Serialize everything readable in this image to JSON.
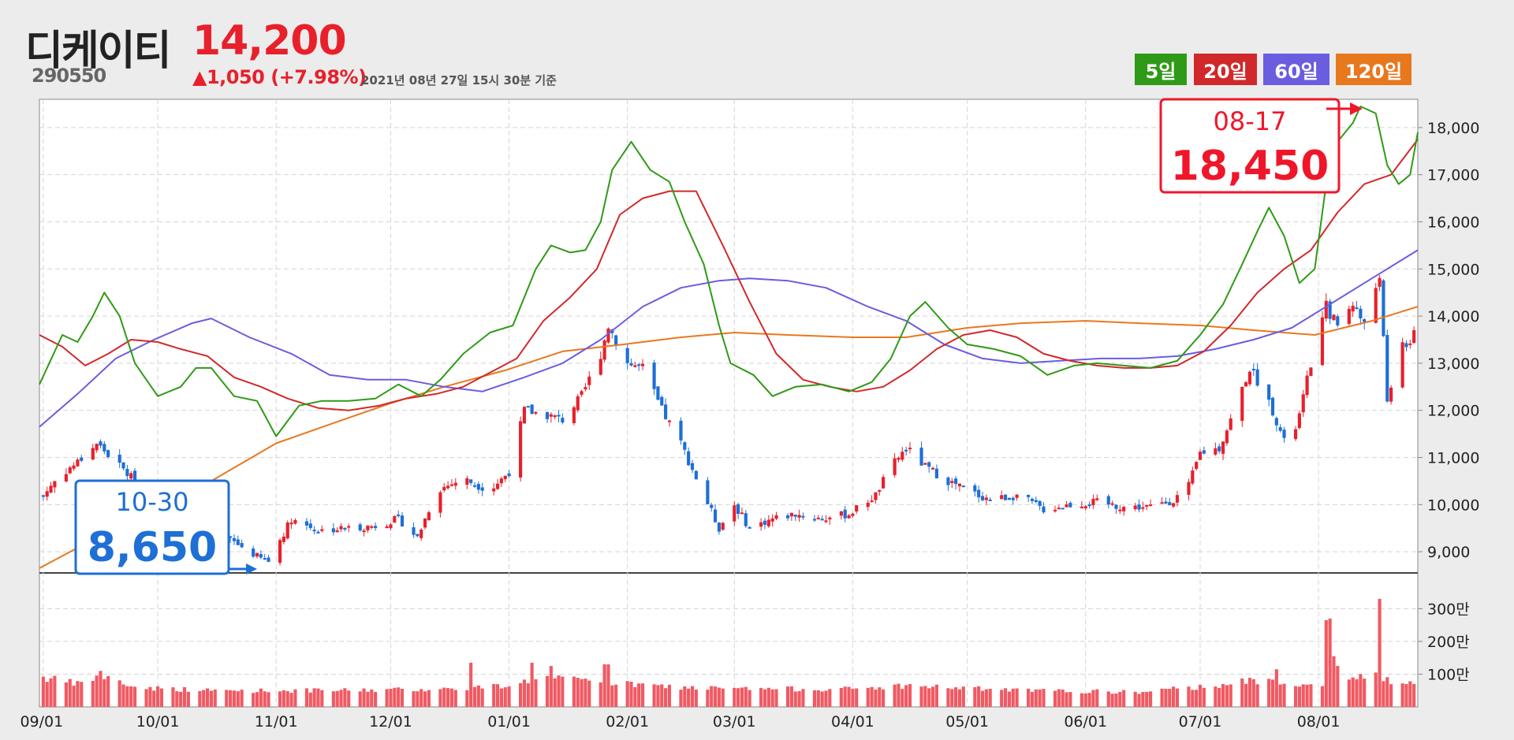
{
  "header": {
    "stock_name": "디케이티",
    "stock_code": "290550",
    "price": "14,200",
    "change": "▲1,050 (+7.98%)",
    "as_of": "2021년 08년 27일 15시 30분 기준"
  },
  "legend": [
    {
      "label": "5일",
      "color": "#2f9a17"
    },
    {
      "label": "20일",
      "color": "#d1292b"
    },
    {
      "label": "60일",
      "color": "#6a5de0"
    },
    {
      "label": "120일",
      "color": "#e8781e"
    }
  ],
  "colors": {
    "up": "#e8202b",
    "down": "#1e6fd6",
    "volume": "#f05a63"
  },
  "annotations": {
    "high": {
      "date": "08-17",
      "value": "18,450"
    },
    "low": {
      "date": "10-30",
      "value": "8,650"
    }
  },
  "chart_data": {
    "type": "candlestick",
    "x_range": [
      "2020-08-31",
      "2021-08-27"
    ],
    "x_ticks": [
      "09/01",
      "10/01",
      "11/01",
      "12/01",
      "01/01",
      "02/01",
      "03/01",
      "04/01",
      "05/01",
      "06/01",
      "07/01",
      "08/01"
    ],
    "price_axis": {
      "ticks": [
        "18,000",
        "17,000",
        "16,000",
        "15,000",
        "14,000",
        "13,000",
        "12,000",
        "11,000",
        "10,000",
        "9,000"
      ],
      "ylim": [
        8550,
        18600
      ]
    },
    "volume_axis": {
      "ticks": [
        "300만",
        "200만",
        "100만"
      ],
      "ylim": [
        0,
        3900000
      ]
    },
    "price_anchors": [
      [
        "2020-09-01",
        10200
      ],
      [
        "2020-09-05",
        10600
      ],
      [
        "2020-09-10",
        10900
      ],
      [
        "2020-09-15",
        11300
      ],
      [
        "2020-09-20",
        10900
      ],
      [
        "2020-09-25",
        10500
      ],
      [
        "2020-10-01",
        10100
      ],
      [
        "2020-10-07",
        9800
      ],
      [
        "2020-10-14",
        9500
      ],
      [
        "2020-10-21",
        9200
      ],
      [
        "2020-10-28",
        8850
      ],
      [
        "2020-10-30",
        8800
      ],
      [
        "2020-11-05",
        9700
      ],
      [
        "2020-11-12",
        9450
      ],
      [
        "2020-11-20",
        9500
      ],
      [
        "2020-11-27",
        9550
      ],
      [
        "2020-12-03",
        9700
      ],
      [
        "2020-12-08",
        9300
      ],
      [
        "2020-12-13",
        10300
      ],
      [
        "2020-12-20",
        10550
      ],
      [
        "2020-12-27",
        10300
      ],
      [
        "2021-01-01",
        10700
      ],
      [
        "2021-01-05",
        12000
      ],
      [
        "2021-01-11",
        11900
      ],
      [
        "2021-01-15",
        11800
      ],
      [
        "2021-01-20",
        12300
      ],
      [
        "2021-01-25",
        13200
      ],
      [
        "2021-01-27",
        13800
      ],
      [
        "2021-02-01",
        13000
      ],
      [
        "2021-02-05",
        12900
      ],
      [
        "2021-02-10",
        12000
      ],
      [
        "2021-02-15",
        11300
      ],
      [
        "2021-02-21",
        10200
      ],
      [
        "2021-02-25",
        9500
      ],
      [
        "2021-03-01",
        10000
      ],
      [
        "2021-03-05",
        9500
      ],
      [
        "2021-03-11",
        9700
      ],
      [
        "2021-03-17",
        9800
      ],
      [
        "2021-03-24",
        9700
      ],
      [
        "2021-03-31",
        9800
      ],
      [
        "2021-04-07",
        10200
      ],
      [
        "2021-04-11",
        10800
      ],
      [
        "2021-04-15",
        11200
      ],
      [
        "2021-04-20",
        10800
      ],
      [
        "2021-04-26",
        10500
      ],
      [
        "2021-05-01",
        10300
      ],
      [
        "2021-05-07",
        10100
      ],
      [
        "2021-05-14",
        10200
      ],
      [
        "2021-05-21",
        9900
      ],
      [
        "2021-05-28",
        10000
      ],
      [
        "2021-06-04",
        10050
      ],
      [
        "2021-06-11",
        9950
      ],
      [
        "2021-06-18",
        9950
      ],
      [
        "2021-06-24",
        10100
      ],
      [
        "2021-06-28",
        10400
      ],
      [
        "2021-07-01",
        11100
      ],
      [
        "2021-07-06",
        11200
      ],
      [
        "2021-07-10",
        12000
      ],
      [
        "2021-07-14",
        12900
      ],
      [
        "2021-07-17",
        12500
      ],
      [
        "2021-07-20",
        12000
      ],
      [
        "2021-07-24",
        11100
      ],
      [
        "2021-07-27",
        11900
      ],
      [
        "2021-07-30",
        13000
      ],
      [
        "2021-08-03",
        14200
      ],
      [
        "2021-08-06",
        13800
      ],
      [
        "2021-08-10",
        14300
      ],
      [
        "2021-08-13",
        13800
      ],
      [
        "2021-08-17",
        14900
      ],
      [
        "2021-08-19",
        12100
      ],
      [
        "2021-08-23",
        13500
      ],
      [
        "2021-08-25",
        13300
      ],
      [
        "2021-08-27",
        14200
      ]
    ],
    "ma5": [
      [
        "2020-08-31",
        12550
      ],
      [
        "2020-09-06",
        13600
      ],
      [
        "2020-09-10",
        13450
      ],
      [
        "2020-09-14",
        14000
      ],
      [
        "2020-09-17",
        14500
      ],
      [
        "2020-09-21",
        14000
      ],
      [
        "2020-09-25",
        13000
      ],
      [
        "2020-10-01",
        12300
      ],
      [
        "2020-10-07",
        12500
      ],
      [
        "2020-10-11",
        12900
      ],
      [
        "2020-10-15",
        12900
      ],
      [
        "2020-10-21",
        12300
      ],
      [
        "2020-10-27",
        12200
      ],
      [
        "2020-11-01",
        11450
      ],
      [
        "2020-11-07",
        12100
      ],
      [
        "2020-11-13",
        12200
      ],
      [
        "2020-11-20",
        12200
      ],
      [
        "2020-11-27",
        12250
      ],
      [
        "2020-12-03",
        12550
      ],
      [
        "2020-12-09",
        12300
      ],
      [
        "2020-12-14",
        12650
      ],
      [
        "2020-12-20",
        13200
      ],
      [
        "2020-12-27",
        13650
      ],
      [
        "2021-01-02",
        13800
      ],
      [
        "2021-01-08",
        15000
      ],
      [
        "2021-01-12",
        15500
      ],
      [
        "2021-01-17",
        15350
      ],
      [
        "2021-01-21",
        15400
      ],
      [
        "2021-01-25",
        16000
      ],
      [
        "2021-01-28",
        17100
      ],
      [
        "2021-02-02",
        17700
      ],
      [
        "2021-02-07",
        17100
      ],
      [
        "2021-02-12",
        16850
      ],
      [
        "2021-02-16",
        16000
      ],
      [
        "2021-02-21",
        15100
      ],
      [
        "2021-02-25",
        13800
      ],
      [
        "2021-02-28",
        13000
      ],
      [
        "2021-03-06",
        12750
      ],
      [
        "2021-03-11",
        12300
      ],
      [
        "2021-03-17",
        12500
      ],
      [
        "2021-03-24",
        12550
      ],
      [
        "2021-03-31",
        12400
      ],
      [
        "2021-04-06",
        12600
      ],
      [
        "2021-04-11",
        13100
      ],
      [
        "2021-04-16",
        14000
      ],
      [
        "2021-04-20",
        14300
      ],
      [
        "2021-04-26",
        13750
      ],
      [
        "2021-05-01",
        13400
      ],
      [
        "2021-05-08",
        13300
      ],
      [
        "2021-05-15",
        13150
      ],
      [
        "2021-05-22",
        12750
      ],
      [
        "2021-05-29",
        12950
      ],
      [
        "2021-06-04",
        13000
      ],
      [
        "2021-06-11",
        12950
      ],
      [
        "2021-06-18",
        12900
      ],
      [
        "2021-06-25",
        13050
      ],
      [
        "2021-07-01",
        13600
      ],
      [
        "2021-07-07",
        14250
      ],
      [
        "2021-07-12",
        15100
      ],
      [
        "2021-07-16",
        15800
      ],
      [
        "2021-07-19",
        16300
      ],
      [
        "2021-07-23",
        15700
      ],
      [
        "2021-07-27",
        14700
      ],
      [
        "2021-07-31",
        15000
      ],
      [
        "2021-08-03",
        16800
      ],
      [
        "2021-08-06",
        17700
      ],
      [
        "2021-08-10",
        18100
      ],
      [
        "2021-08-12",
        18450
      ],
      [
        "2021-08-16",
        18300
      ],
      [
        "2021-08-19",
        17200
      ],
      [
        "2021-08-22",
        16800
      ],
      [
        "2021-08-25",
        17000
      ],
      [
        "2021-08-27",
        17900
      ]
    ],
    "ma20": [
      [
        "2020-08-31",
        13600
      ],
      [
        "2020-09-06",
        13350
      ],
      [
        "2020-09-12",
        12950
      ],
      [
        "2020-09-18",
        13200
      ],
      [
        "2020-09-24",
        13500
      ],
      [
        "2020-10-01",
        13450
      ],
      [
        "2020-10-07",
        13300
      ],
      [
        "2020-10-14",
        13150
      ],
      [
        "2020-10-21",
        12700
      ],
      [
        "2020-10-28",
        12500
      ],
      [
        "2020-11-04",
        12250
      ],
      [
        "2020-11-12",
        12050
      ],
      [
        "2020-11-20",
        12000
      ],
      [
        "2020-11-28",
        12100
      ],
      [
        "2020-12-05",
        12250
      ],
      [
        "2020-12-13",
        12350
      ],
      [
        "2020-12-20",
        12500
      ],
      [
        "2020-12-27",
        12800
      ],
      [
        "2021-01-03",
        13100
      ],
      [
        "2021-01-10",
        13900
      ],
      [
        "2021-01-17",
        14400
      ],
      [
        "2021-01-24",
        15000
      ],
      [
        "2021-01-30",
        16150
      ],
      [
        "2021-02-05",
        16500
      ],
      [
        "2021-02-12",
        16650
      ],
      [
        "2021-02-19",
        16650
      ],
      [
        "2021-02-26",
        15500
      ],
      [
        "2021-03-05",
        14300
      ],
      [
        "2021-03-12",
        13200
      ],
      [
        "2021-03-19",
        12650
      ],
      [
        "2021-03-26",
        12500
      ],
      [
        "2021-04-02",
        12400
      ],
      [
        "2021-04-09",
        12500
      ],
      [
        "2021-04-16",
        12850
      ],
      [
        "2021-04-23",
        13300
      ],
      [
        "2021-04-30",
        13600
      ],
      [
        "2021-05-07",
        13700
      ],
      [
        "2021-05-14",
        13550
      ],
      [
        "2021-05-21",
        13200
      ],
      [
        "2021-05-28",
        13050
      ],
      [
        "2021-06-04",
        12950
      ],
      [
        "2021-06-11",
        12900
      ],
      [
        "2021-06-18",
        12900
      ],
      [
        "2021-06-25",
        12950
      ],
      [
        "2021-07-02",
        13250
      ],
      [
        "2021-07-09",
        13800
      ],
      [
        "2021-07-16",
        14500
      ],
      [
        "2021-07-23",
        15000
      ],
      [
        "2021-07-30",
        15400
      ],
      [
        "2021-08-06",
        16200
      ],
      [
        "2021-08-13",
        16800
      ],
      [
        "2021-08-20",
        17000
      ],
      [
        "2021-08-27",
        17750
      ]
    ],
    "ma60": [
      [
        "2020-08-31",
        11650
      ],
      [
        "2020-09-10",
        12350
      ],
      [
        "2020-09-20",
        13100
      ],
      [
        "2020-09-30",
        13500
      ],
      [
        "2020-10-10",
        13850
      ],
      [
        "2020-10-15",
        13950
      ],
      [
        "2020-10-25",
        13550
      ],
      [
        "2020-11-05",
        13200
      ],
      [
        "2020-11-15",
        12750
      ],
      [
        "2020-11-25",
        12650
      ],
      [
        "2020-12-05",
        12650
      ],
      [
        "2020-12-15",
        12500
      ],
      [
        "2020-12-25",
        12400
      ],
      [
        "2021-01-05",
        12700
      ],
      [
        "2021-01-15",
        13000
      ],
      [
        "2021-01-25",
        13500
      ],
      [
        "2021-02-05",
        14200
      ],
      [
        "2021-02-15",
        14600
      ],
      [
        "2021-02-25",
        14750
      ],
      [
        "2021-03-05",
        14800
      ],
      [
        "2021-03-15",
        14750
      ],
      [
        "2021-03-25",
        14600
      ],
      [
        "2021-04-05",
        14200
      ],
      [
        "2021-04-15",
        13900
      ],
      [
        "2021-04-25",
        13400
      ],
      [
        "2021-05-05",
        13100
      ],
      [
        "2021-05-15",
        13000
      ],
      [
        "2021-05-25",
        13050
      ],
      [
        "2021-06-05",
        13100
      ],
      [
        "2021-06-15",
        13100
      ],
      [
        "2021-06-25",
        13150
      ],
      [
        "2021-07-05",
        13300
      ],
      [
        "2021-07-15",
        13500
      ],
      [
        "2021-07-25",
        13750
      ],
      [
        "2021-08-05",
        14300
      ],
      [
        "2021-08-15",
        14800
      ],
      [
        "2021-08-27",
        15400
      ]
    ],
    "ma120": [
      [
        "2020-08-31",
        8650
      ],
      [
        "2020-09-15",
        9300
      ],
      [
        "2020-10-01",
        9950
      ],
      [
        "2020-10-15",
        10500
      ],
      [
        "2020-11-01",
        11300
      ],
      [
        "2020-11-15",
        11700
      ],
      [
        "2020-12-01",
        12150
      ],
      [
        "2020-12-15",
        12500
      ],
      [
        "2020-12-31",
        12850
      ],
      [
        "2021-01-15",
        13250
      ],
      [
        "2021-01-31",
        13400
      ],
      [
        "2021-02-15",
        13550
      ],
      [
        "2021-03-01",
        13650
      ],
      [
        "2021-03-15",
        13600
      ],
      [
        "2021-04-01",
        13550
      ],
      [
        "2021-04-15",
        13550
      ],
      [
        "2021-05-01",
        13750
      ],
      [
        "2021-05-15",
        13850
      ],
      [
        "2021-06-01",
        13900
      ],
      [
        "2021-06-15",
        13850
      ],
      [
        "2021-07-01",
        13800
      ],
      [
        "2021-07-15",
        13700
      ],
      [
        "2021-07-31",
        13600
      ],
      [
        "2021-08-15",
        13900
      ],
      [
        "2021-08-27",
        14200
      ]
    ],
    "volume_anchors": [
      [
        "2020-09-01",
        900000
      ],
      [
        "2020-09-10",
        700000
      ],
      [
        "2020-09-16",
        950000
      ],
      [
        "2020-09-25",
        600000
      ],
      [
        "2020-10-15",
        500000
      ],
      [
        "2020-11-15",
        500000
      ],
      [
        "2020-12-15",
        550000
      ],
      [
        "2020-12-31",
        650000
      ],
      [
        "2021-01-10",
        900000
      ],
      [
        "2021-01-20",
        800000
      ],
      [
        "2021-01-31",
        700000
      ],
      [
        "2021-02-15",
        600000
      ],
      [
        "2021-03-01",
        550000
      ],
      [
        "2021-04-01",
        550000
      ],
      [
        "2021-04-15",
        650000
      ],
      [
        "2021-05-15",
        500000
      ],
      [
        "2021-06-15",
        450000
      ],
      [
        "2021-06-30",
        600000
      ],
      [
        "2021-07-15",
        800000
      ],
      [
        "2021-07-31",
        700000
      ],
      [
        "2021-08-10",
        900000
      ],
      [
        "2021-08-27",
        700000
      ]
    ],
    "volume_spikes": [
      [
        "2020-09-16",
        1100000
      ],
      [
        "2020-12-12",
        1200000
      ],
      [
        "2020-12-22",
        1350000
      ],
      [
        "2021-01-07",
        1350000
      ],
      [
        "2021-01-12",
        1250000
      ],
      [
        "2021-01-26",
        1300000
      ],
      [
        "2021-01-27",
        1300000
      ],
      [
        "2021-07-18",
        1100000
      ],
      [
        "2021-07-21",
        1150000
      ],
      [
        "2021-08-03",
        2650000
      ],
      [
        "2021-08-04",
        2700000
      ],
      [
        "2021-08-05",
        1550000
      ],
      [
        "2021-08-06",
        1250000
      ],
      [
        "2021-08-17",
        3300000
      ],
      [
        "2021-08-16",
        1050000
      ]
    ]
  }
}
